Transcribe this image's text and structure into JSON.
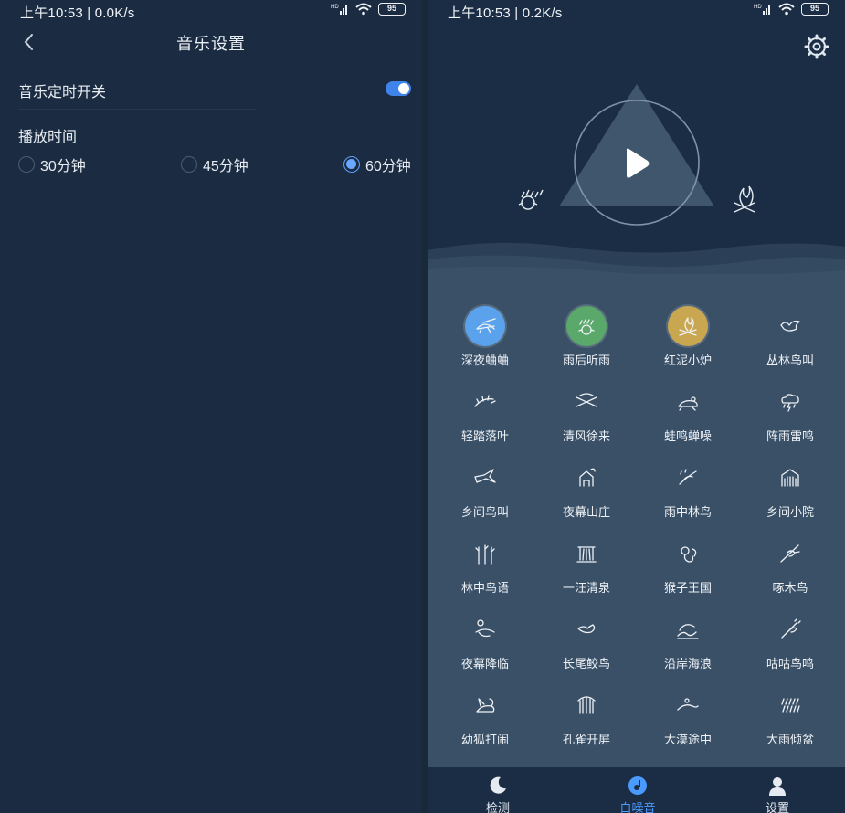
{
  "left": {
    "status": {
      "time": "上午10:53 | 0.0K/s",
      "battery": "95"
    },
    "header": {
      "title": "音乐设置"
    },
    "timer_switch": {
      "label": "音乐定时开关",
      "enabled": true
    },
    "play_time": {
      "label": "播放时间",
      "options": [
        {
          "label": "30分钟",
          "selected": false
        },
        {
          "label": "45分钟",
          "selected": false
        },
        {
          "label": "60分钟",
          "selected": true
        }
      ]
    }
  },
  "right": {
    "status": {
      "time": "上午10:53 | 0.2K/s",
      "battery": "95"
    },
    "sounds": [
      {
        "label": "深夜蛐蛐",
        "icon": "cricket-icon",
        "active_color": "#5aa3ec"
      },
      {
        "label": "雨后听雨",
        "icon": "rain-face-icon",
        "active_color": "#5aa86a"
      },
      {
        "label": "红泥小炉",
        "icon": "campfire-icon",
        "active_color": "#c9a650"
      },
      {
        "label": "丛林鸟叫",
        "icon": "bird-icon"
      },
      {
        "label": "轻踏落叶",
        "icon": "leaves-icon"
      },
      {
        "label": "清风徐来",
        "icon": "wind-icon"
      },
      {
        "label": "蛙鸣蝉噪",
        "icon": "frog-icon"
      },
      {
        "label": "阵雨雷鸣",
        "icon": "thunderstorm-icon"
      },
      {
        "label": "乡间鸟叫",
        "icon": "swallow-icon"
      },
      {
        "label": "夜幕山庄",
        "icon": "night-villa-icon"
      },
      {
        "label": "雨中林鸟",
        "icon": "rain-bird-icon"
      },
      {
        "label": "乡间小院",
        "icon": "yard-icon"
      },
      {
        "label": "林中鸟语",
        "icon": "forest-bird-icon"
      },
      {
        "label": "一汪清泉",
        "icon": "spring-icon"
      },
      {
        "label": "猴子王国",
        "icon": "monkey-icon"
      },
      {
        "label": "啄木鸟",
        "icon": "woodpecker-icon"
      },
      {
        "label": "夜幕降临",
        "icon": "nightfall-icon"
      },
      {
        "label": "长尾鲛鸟",
        "icon": "longtail-bird-icon"
      },
      {
        "label": "沿岸海浪",
        "icon": "wave-icon"
      },
      {
        "label": "咕咕鸟鸣",
        "icon": "cuckoo-icon"
      },
      {
        "label": "幼狐打闹",
        "icon": "fox-icon"
      },
      {
        "label": "孔雀开屏",
        "icon": "peacock-icon"
      },
      {
        "label": "大漠途中",
        "icon": "desert-icon"
      },
      {
        "label": "大雨倾盆",
        "icon": "heavy-rain-icon"
      }
    ],
    "nav": [
      {
        "label": "检测",
        "icon": "moon-icon",
        "active": false
      },
      {
        "label": "白噪音",
        "icon": "music-disc-icon",
        "active": true
      },
      {
        "label": "设置",
        "icon": "user-icon",
        "active": false
      }
    ]
  },
  "colors": {
    "accent": "#3f84ea",
    "nav_active": "#4b9bff",
    "background": "#1b2c42",
    "panel": "#3a5067"
  }
}
